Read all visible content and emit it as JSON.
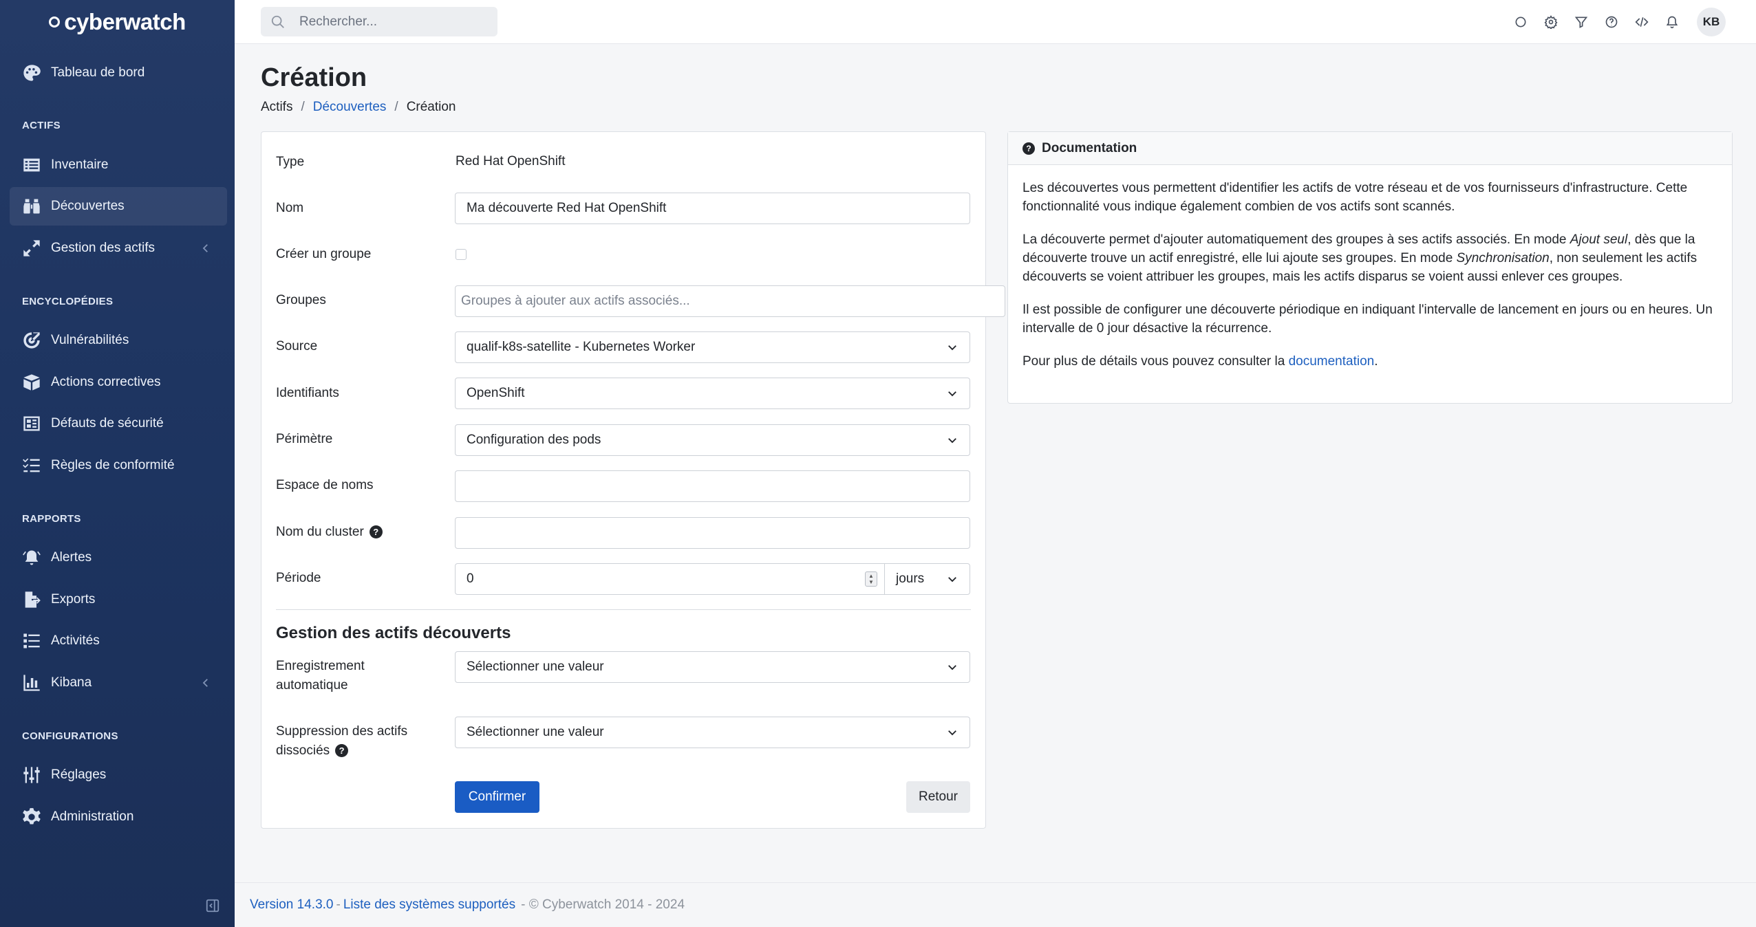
{
  "brand": {
    "name": "cyberwatch"
  },
  "sidebar": {
    "items": [
      {
        "label": "Tableau de bord",
        "icon": "palette-icon"
      },
      {
        "label": "Inventaire",
        "icon": "list-icon"
      },
      {
        "label": "Découvertes",
        "icon": "binoculars-icon",
        "active": true
      },
      {
        "label": "Gestion des actifs",
        "icon": "expand-arrows-icon",
        "has_submenu": true
      },
      {
        "label": "Vulnérabilités",
        "icon": "target-icon"
      },
      {
        "label": "Actions correctives",
        "icon": "box-icon"
      },
      {
        "label": "Défauts de sécurité",
        "icon": "dashboard-screen-icon"
      },
      {
        "label": "Règles de conformité",
        "icon": "checklist-icon"
      },
      {
        "label": "Alertes",
        "icon": "bell-ring-icon"
      },
      {
        "label": "Exports",
        "icon": "file-export-icon"
      },
      {
        "label": "Activités",
        "icon": "activity-list-icon"
      },
      {
        "label": "Kibana",
        "icon": "bar-chart-icon",
        "has_submenu": true
      },
      {
        "label": "Réglages",
        "icon": "sliders-icon"
      },
      {
        "label": "Administration",
        "icon": "cog-icon"
      }
    ],
    "sections": {
      "actifs": "ACTIFS",
      "encyclopedies": "ENCYCLOPÉDIES",
      "rapports": "RAPPORTS",
      "configurations": "CONFIGURATIONS"
    }
  },
  "topbar": {
    "search_placeholder": "Rechercher...",
    "avatar_initials": "KB",
    "icons": [
      "circle-icon",
      "settings-icon",
      "filter-icon",
      "help-circle-icon",
      "code-icon",
      "bell-icon"
    ]
  },
  "page": {
    "title": "Création",
    "breadcrumb": {
      "root": "Actifs",
      "parent": "Découvertes",
      "current": "Création",
      "separator": "/"
    }
  },
  "form": {
    "type_label": "Type",
    "type_value": "Red Hat OpenShift",
    "name_label": "Nom",
    "name_value": "Ma découverte Red Hat OpenShift",
    "create_group_label": "Créer un groupe",
    "groups_label": "Groupes",
    "groups_placeholder": "Groupes à ajouter aux actifs associés...",
    "source_label": "Source",
    "source_value": "qualif-k8s-satellite - Kubernetes Worker",
    "credentials_label": "Identifiants",
    "credentials_value": "OpenShift",
    "scope_label": "Périmètre",
    "scope_value": "Configuration des pods",
    "namespace_label": "Espace de noms",
    "namespace_value": "",
    "cluster_label": "Nom du cluster",
    "cluster_value": "",
    "period_label": "Période",
    "period_value": "0",
    "period_unit": "jours",
    "section_title": "Gestion des actifs découverts",
    "auto_register_label_1": "Enregistrement",
    "auto_register_label_2": "automatique",
    "auto_register_value": "Sélectionner une valeur",
    "delete_label_1": "Suppression des actifs",
    "delete_label_2": "dissociés",
    "delete_value": "Sélectionner une valeur",
    "confirm_label": "Confirmer",
    "back_label": "Retour",
    "help_glyph": "?"
  },
  "documentation": {
    "title": "Documentation",
    "p1": "Les découvertes vous permettent d'identifier les actifs de votre réseau et de vos fournisseurs d'infrastructure. Cette fonctionnalité vous indique également combien de vos actifs sont scannés.",
    "p2_a": "La découverte permet d'ajouter automatiquement des groupes à ses actifs associés. En mode ",
    "p2_em1": "Ajout seul",
    "p2_b": ", dès que la découverte trouve un actif enregistré, elle lui ajoute ses groupes. En mode ",
    "p2_em2": "Synchronisation",
    "p2_c": ", non seulement les actifs découverts se voient attribuer les groupes, mais les actifs disparus se voient aussi enlever ces groupes.",
    "p3": "Il est possible de configurer une découverte périodique en indiquant l'intervalle de lancement en jours ou en heures. Un intervalle de 0 jour désactive la récurrence.",
    "p4_a": "Pour plus de détails vous pouvez consulter la ",
    "p4_link": "documentation",
    "p4_b": "."
  },
  "footer": {
    "version": "Version 14.3.0",
    "sep": "-",
    "supported": "Liste des systèmes supportés",
    "copyright": "- © Cyberwatch 2014 - 2024"
  },
  "colors": {
    "sidebar": "#1d3460",
    "accent": "#1a5cc4",
    "link": "#1d5fbf"
  }
}
